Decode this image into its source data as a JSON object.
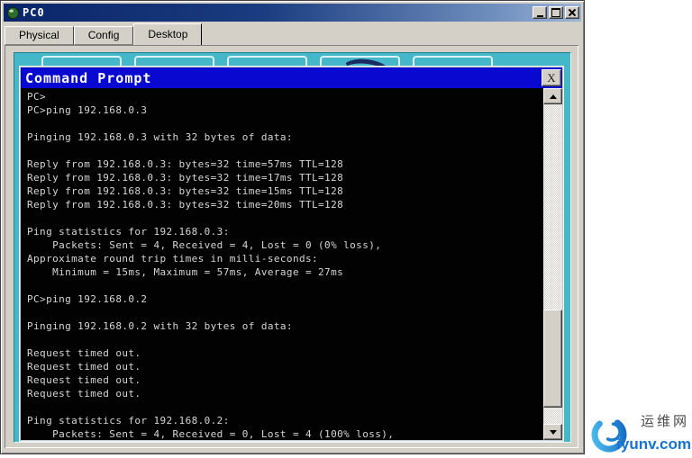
{
  "window": {
    "title": "PC0"
  },
  "tabs": [
    {
      "label": "Physical",
      "active": false
    },
    {
      "label": "Config",
      "active": false
    },
    {
      "label": "Desktop",
      "active": true
    }
  ],
  "desktop": {
    "visible_icon_frames": 5,
    "icon_frame_lefts": [
      30,
      133,
      236,
      339,
      442
    ]
  },
  "cmd_window": {
    "title": "Command Prompt",
    "close_label": "X"
  },
  "terminal": {
    "lines": [
      "PC>",
      "PC>ping 192.168.0.3",
      "",
      "Pinging 192.168.0.3 with 32 bytes of data:",
      "",
      "Reply from 192.168.0.3: bytes=32 time=57ms TTL=128",
      "Reply from 192.168.0.3: bytes=32 time=17ms TTL=128",
      "Reply from 192.168.0.3: bytes=32 time=15ms TTL=128",
      "Reply from 192.168.0.3: bytes=32 time=20ms TTL=128",
      "",
      "Ping statistics for 192.168.0.3:",
      "    Packets: Sent = 4, Received = 4, Lost = 0 (0% loss),",
      "Approximate round trip times in milli-seconds:",
      "    Minimum = 15ms, Maximum = 57ms, Average = 27ms",
      "",
      "PC>ping 192.168.0.2",
      "",
      "Pinging 192.168.0.2 with 32 bytes of data:",
      "",
      "Request timed out.",
      "Request timed out.",
      "Request timed out.",
      "Request timed out.",
      "",
      "Ping statistics for 192.168.0.2:",
      "    Packets: Sent = 4, Received = 0, Lost = 4 (100% loss),"
    ]
  },
  "watermark": {
    "site_name": "运维网",
    "site_url": "iyunv.com",
    "brand_color": "#1673d2"
  },
  "colors": {
    "titlebar_gradient_start": "#0a2569",
    "titlebar_gradient_end": "#9db3d6",
    "dialog_gray": "#d4d0c8",
    "desktop_teal": "#44b7c9",
    "cmd_titlebar_blue": "#0808d0",
    "terminal_bg": "#020202",
    "terminal_text": "#d6d6d6"
  }
}
